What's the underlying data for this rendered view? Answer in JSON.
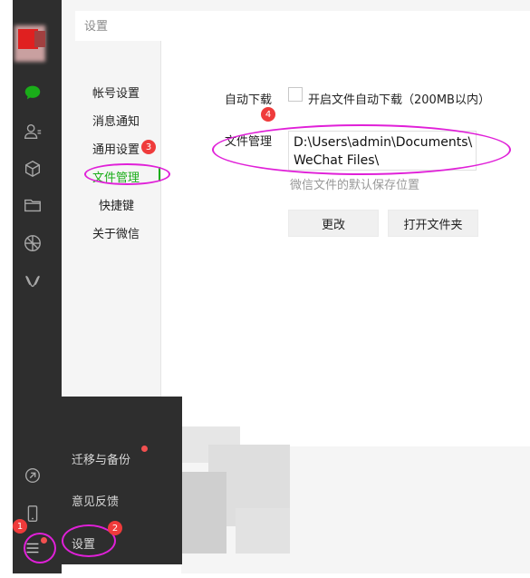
{
  "dialog": {
    "title": "设置"
  },
  "settings_nav": [
    {
      "label": "帐号设置"
    },
    {
      "label": "消息通知"
    },
    {
      "label": "通用设置"
    },
    {
      "label": "文件管理",
      "active": true
    },
    {
      "label": "快捷键"
    },
    {
      "label": "关于微信"
    }
  ],
  "file_management": {
    "auto_download_label": "自动下载",
    "auto_download_checkbox_label": "开启文件自动下载（200MB以内）",
    "auto_download_checked": false,
    "section_label": "文件管理",
    "path_value": "D:\\Users\\admin\\Documents\\\nWeChat Files\\",
    "hint": "微信文件的默认保存位置",
    "change_button": "更改",
    "open_folder_button": "打开文件夹"
  },
  "popup_menu": [
    {
      "label": "迁移与备份",
      "has_badge": true
    },
    {
      "label": "意见反馈"
    },
    {
      "label": "设置"
    }
  ],
  "annotations": [
    "1",
    "2",
    "3",
    "4"
  ],
  "sidebar_icons": [
    "chat-icon",
    "contacts-icon",
    "favorites-icon",
    "files-icon",
    "moments-icon",
    "mini-programs-icon",
    "link-icon",
    "phone-icon",
    "menu-icon"
  ],
  "colors": {
    "sidebar": "#2e2e2e",
    "accent_green": "#1aad19",
    "annotation_magenta": "#e020d8",
    "badge_red": "#ef3b3b"
  }
}
